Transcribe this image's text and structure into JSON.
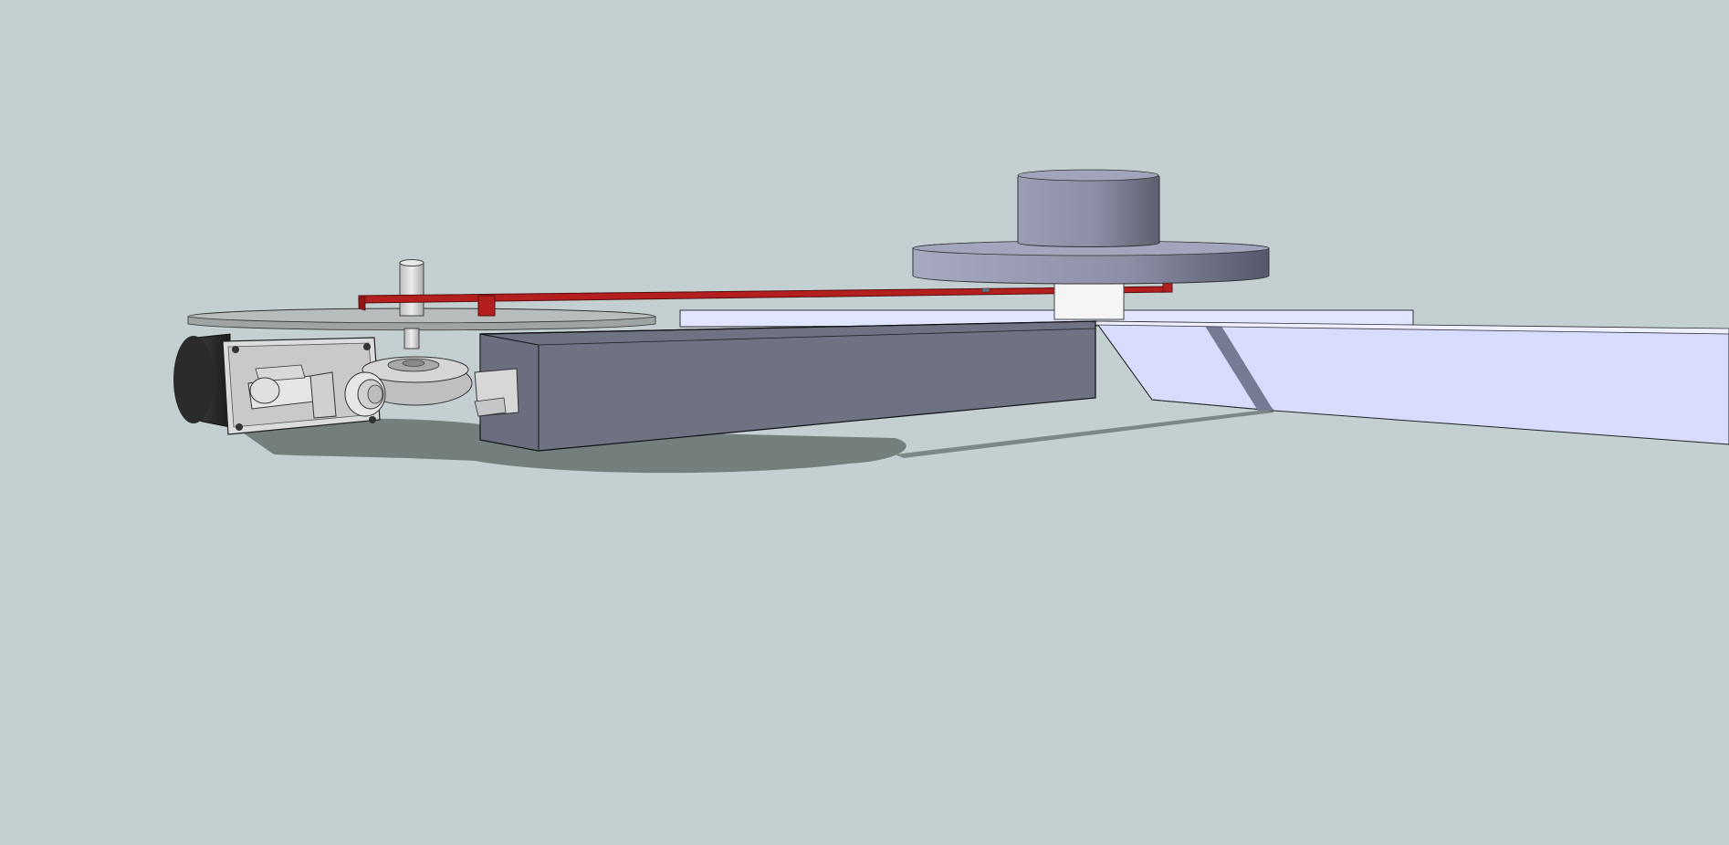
{
  "viewport": {
    "background_color": "#c3cfd1"
  },
  "model": {
    "components": [
      {
        "name": "drive-motor",
        "icon": "motor-icon",
        "color": "#2a2a2a"
      },
      {
        "name": "worm-gearbox",
        "icon": "gearbox-icon",
        "color": "#c8c8c8"
      },
      {
        "name": "turntable-disk",
        "icon": "disk-icon",
        "color": "#b9bcbc"
      },
      {
        "name": "drive-shaft",
        "icon": "shaft-icon",
        "color": "#d4d4d4"
      },
      {
        "name": "red-linkage-arm",
        "icon": "arm-icon",
        "color": "#b31f1f"
      },
      {
        "name": "support-beam",
        "icon": "beam-icon",
        "color": "#6e7283"
      },
      {
        "name": "flanged-hub",
        "icon": "hub-icon",
        "color": "#8f91a8"
      },
      {
        "name": "white-spacer",
        "icon": "spacer-icon",
        "color": "#f2f2f2"
      },
      {
        "name": "base-plate",
        "icon": "plate-icon",
        "color": "#d8dcff"
      }
    ]
  }
}
